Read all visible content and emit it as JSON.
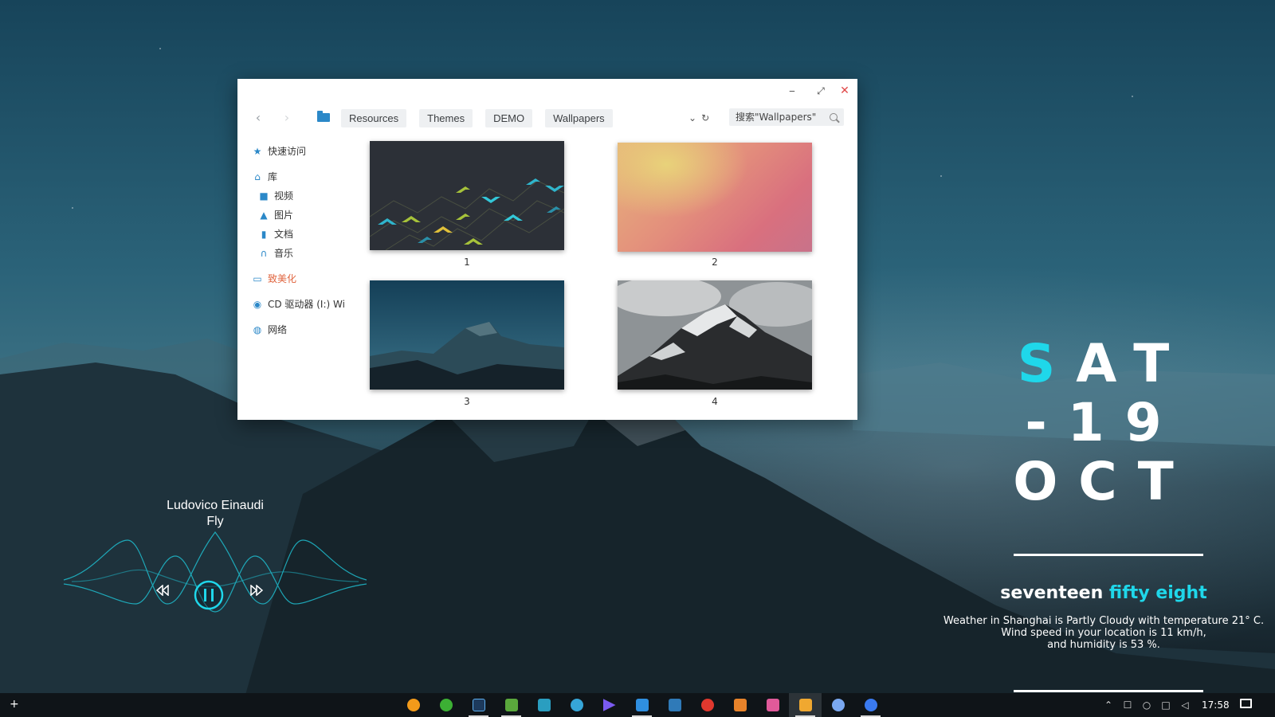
{
  "window": {
    "controls": {
      "minimize": "‒",
      "maximize": "⤢",
      "close": "✕"
    },
    "breadcrumbs": [
      "Resources",
      "Themes",
      "DEMO",
      "Wallpapers"
    ],
    "search_placeholder": "搜索\"Wallpapers\"",
    "sidebar": {
      "quick_access": "快速访问",
      "library": "库",
      "videos": "视频",
      "pictures": "图片",
      "documents": "文档",
      "music": "音乐",
      "beautify": "致美化",
      "cd_drive": "CD 驱动器 (I:) Wi",
      "network": "网络"
    },
    "thumbnails": [
      {
        "label": "1"
      },
      {
        "label": "2"
      },
      {
        "label": "3"
      },
      {
        "label": "4"
      }
    ]
  },
  "music": {
    "artist": "Ludovico Einaudi",
    "track": "Fly"
  },
  "date_widget": {
    "day_first": "S",
    "day_rest": "AT",
    "date": "-19",
    "month": "OCT",
    "time_words": "seventeen",
    "time_words_accent": "fifty eight",
    "weather_line1": "Weather in Shanghai is Partly Cloudy with temperature 21° C.",
    "weather_line2": "Wind speed in your location is 11 km/h,",
    "weather_line3": "and humidity is 53 %."
  },
  "taskbar": {
    "start": "+",
    "clock": "17:58",
    "apps": [
      {
        "name": "weibo",
        "color": "#f29a1a"
      },
      {
        "name": "wechat",
        "color": "#3cb034"
      },
      {
        "name": "photoshop",
        "color": "#1d3a5c"
      },
      {
        "name": "sketch-editor",
        "color": "#5aa83c"
      },
      {
        "name": "photos",
        "color": "#2a9ec0"
      },
      {
        "name": "palette",
        "color": "#36a6d8"
      },
      {
        "name": "media-player",
        "color": "#7a5af0"
      },
      {
        "name": "clipboard",
        "color": "#2f8fe0"
      },
      {
        "name": "terminal",
        "color": "#2f7ab8"
      },
      {
        "name": "netease-music",
        "color": "#e0382e"
      },
      {
        "name": "office",
        "color": "#e8832a"
      },
      {
        "name": "xiu",
        "color": "#e05a9a"
      },
      {
        "name": "file-explorer",
        "color": "#f0a830"
      },
      {
        "name": "qq",
        "color": "#7aa8f0"
      },
      {
        "name": "browser",
        "color": "#3a7af0"
      }
    ]
  },
  "colors": {
    "accent": "#1fd7ea",
    "sidebar_active": "#e0643e",
    "folder": "#2b88c8"
  }
}
